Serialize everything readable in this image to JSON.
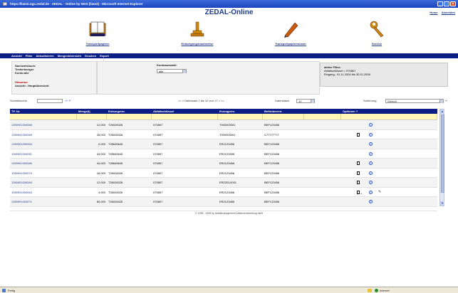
{
  "window": {
    "title": "https://liam2.ngo.zedal.de · ZEDAL · Online by NGS (liam2) · Microsoft Internet Explorer"
  },
  "header": {
    "app_title": "ZEDAL-Online",
    "links": [
      "Home",
      "Abmelden"
    ]
  },
  "nav": [
    {
      "label": "Transportpapiere",
      "icon": "book-icon"
    },
    {
      "label": "Entsorgungsnachweise",
      "icon": "trophy-icon"
    },
    {
      "label": "Transportpapiermuster",
      "icon": "pen-icon"
    },
    {
      "label": "Service",
      "icon": "wrench-icon"
    }
  ],
  "menu": [
    "Ansicht",
    "Filter",
    "Aktualisieren",
    "Mengenübersicht",
    "Drucken",
    "Export"
  ],
  "info": {
    "nachweisbuch": "Nachweisbuch:",
    "testentsorger": "Testentsorger",
    "konto": "Konto:alle",
    "hinweise": "Hinweise:",
    "ansicht": "Ansicht : Hauptübersicht",
    "kontoauswahl_label": "Kontoauswahl:",
    "kontoauswahl_value": "alle"
  },
  "filter": {
    "title": "aktive Filter:",
    "line1": "Abfallschlüssel = 070807",
    "line2": "Eingang : 01.11.2004 bis 30.11.2006"
  },
  "toolbar": {
    "schnellsuche_label": "Schnellsuche",
    "paging": "<< < Datensatz 1 bis 10 von 17 > >>",
    "datensaetze_label": "Datensätze",
    "datensaetze_value": "10",
    "sortierung_label": "Sortierung",
    "sortierung_value": "Default"
  },
  "table": {
    "headers": [
      "TP. Nr.",
      "Menge(t)",
      "Entsorgernr.",
      "Abfallschlüssel",
      "Erzeugernr.",
      "Beförderernr.",
      "Optionen"
    ],
    "rows": [
      {
        "tp": "1390901000085",
        "menge": "12,000",
        "entsorger": "T26026026",
        "abfall": "070807",
        "erzeuger": "T000000001",
        "befoerderer": "BEF123456",
        "icons": [
          "info"
        ]
      },
      {
        "tp": "1390901000065",
        "menge": "26,000",
        "entsorger": "T26026026",
        "abfall": "070807",
        "erzeuger": "T000000001",
        "befoerderer": "C77777777",
        "icons": [
          "doc",
          "info"
        ]
      },
      {
        "tp": "1390901000054",
        "menge": "0,000",
        "entsorger": "T45645645",
        "abfall": "070807",
        "erzeuger": "ER2123456",
        "befoerderer": "BEF123456",
        "icons": [
          "info"
        ]
      },
      {
        "tp": "1390901000081",
        "menge": "44,000",
        "entsorger": "T45645645",
        "abfall": "070807",
        "erzeuger": "ER2123456",
        "befoerderer": "BEF123456",
        "icons": [
          "info"
        ]
      },
      {
        "tp": "1390901000080",
        "menge": "44,000",
        "entsorger": "T45645645",
        "abfall": "070807",
        "erzeuger": "ER2123456",
        "befoerderer": "BEF123456",
        "icons": [
          "doc",
          "info"
        ]
      },
      {
        "tp": "1390901000070",
        "menge": "16,000",
        "entsorger": "T26026026",
        "abfall": "070807",
        "erzeuger": "ER2123456",
        "befoerderer": "BEF123456",
        "icons": [
          "doc",
          "info"
        ]
      },
      {
        "tp": "1390901000064",
        "menge": "12,000",
        "entsorger": "T26026026",
        "abfall": "070807",
        "erzeuger": "ER2ZEL0001",
        "befoerderer": "BEF123456",
        "icons": [
          "doc",
          "info"
        ]
      },
      {
        "tp": "1390901000063",
        "menge": "4,000",
        "entsorger": "T26026026",
        "abfall": "070807",
        "erzeuger": "ER2123456",
        "befoerderer": "BEF123456",
        "icons": [
          "doc-plus",
          "info",
          "pen"
        ]
      },
      {
        "tp": "1390901000071",
        "menge": "60,000",
        "entsorger": "T26026026",
        "abfall": "070807",
        "erzeuger": "ER2123456",
        "befoerderer": "BEF123456",
        "icons": [
          "info"
        ]
      }
    ]
  },
  "copyright": "© 1999 - 2006 by Abfallmanagement Datenverarbeitung mbH",
  "status": {
    "left": "Fertig",
    "right": "Internet"
  },
  "colors": {
    "nav_blue": "#0b1e86",
    "link_blue": "#1f3b88",
    "filter_yellow": "#fdf7b6"
  }
}
